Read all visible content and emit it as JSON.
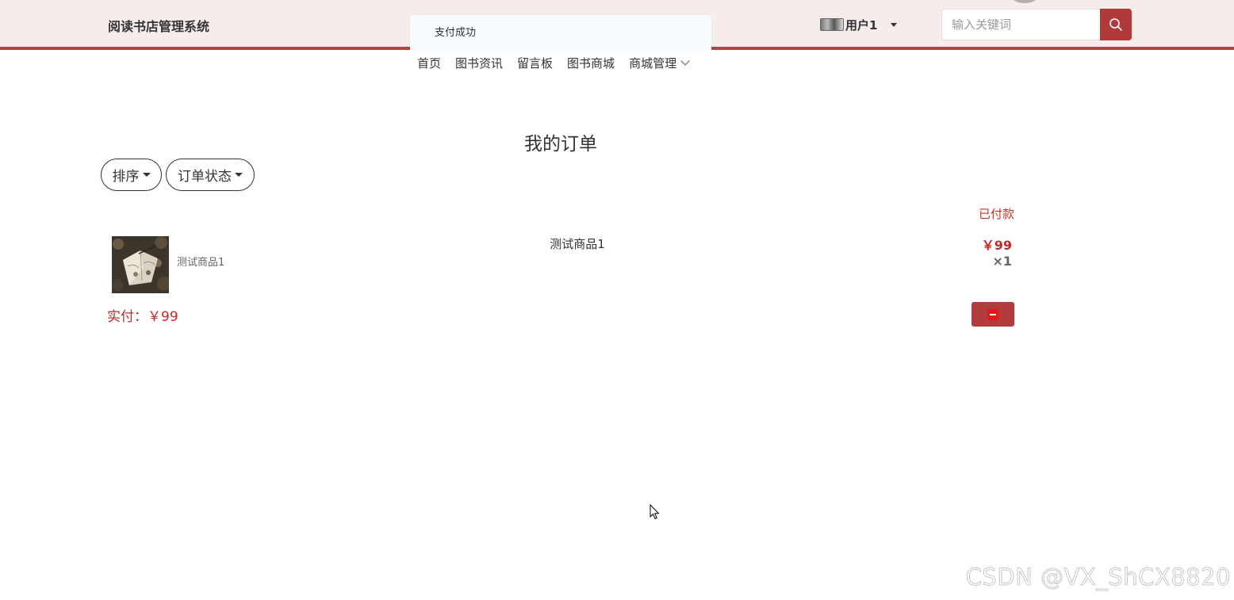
{
  "header": {
    "site_title": "阅读书店管理系统",
    "user_name": "用户1",
    "search_placeholder": "输入关键词"
  },
  "toast": {
    "message": "支付成功"
  },
  "nav": {
    "items": [
      "首页",
      "图书资讯",
      "留言板",
      "图书商城",
      "商城管理"
    ]
  },
  "main": {
    "page_title": "我的订单",
    "filters": {
      "sort_label": "排序",
      "status_label": "订单状态"
    },
    "order": {
      "status": "已付款",
      "item": {
        "thumb_name": "测试商品1",
        "title": "测试商品1",
        "price": "￥99",
        "quantity": "×1"
      },
      "paid_label": "实付：",
      "paid_amount": "￥99"
    }
  },
  "watermark": "CSDN @VX_ShCX8820",
  "colors": {
    "accent": "#b03a3a",
    "header_bg": "#f7ecec",
    "price": "#c62828"
  }
}
